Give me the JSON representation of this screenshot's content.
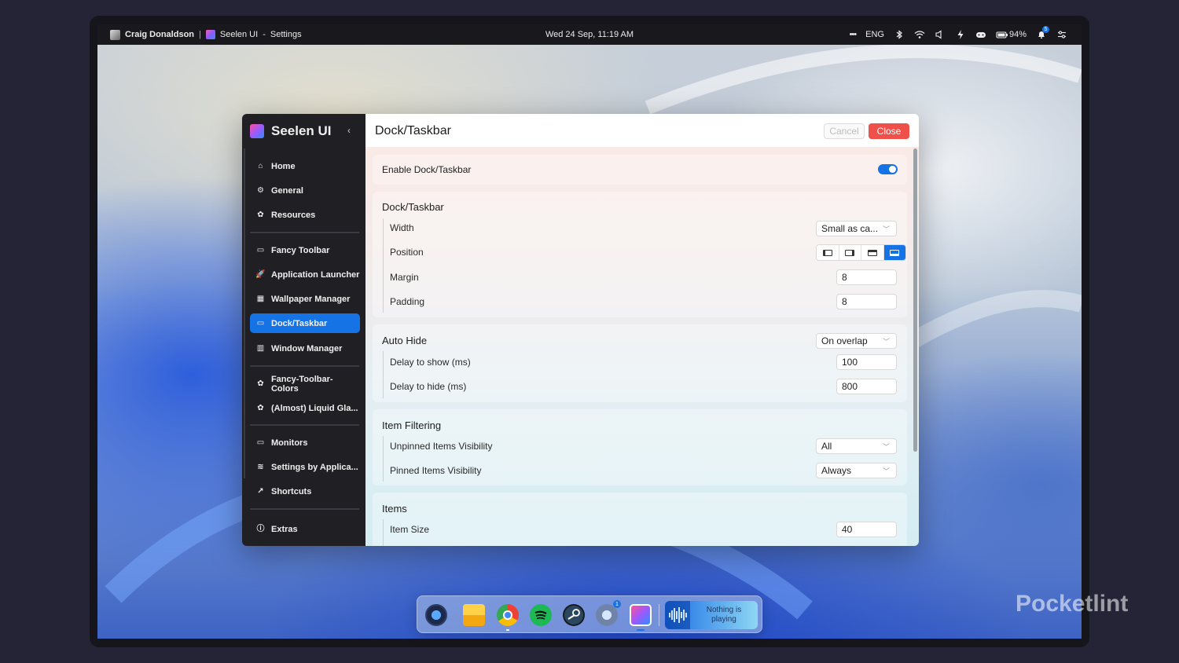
{
  "topbar": {
    "user": "Craig Donaldson",
    "separator": "|",
    "app_name": "Seelen UI",
    "app_dash": "-",
    "app_page": "Settings",
    "datetime": "Wed 24 Sep, 11:19 AM",
    "more": "•••",
    "language": "ENG",
    "battery": "94%",
    "notification_count": "5"
  },
  "sidebar": {
    "brand": "Seelen UI",
    "collapse": "‹",
    "items": [
      {
        "label": "Home",
        "icon": "⌂"
      },
      {
        "label": "General",
        "icon": "⚙"
      },
      {
        "label": "Resources",
        "icon": "✿"
      },
      {
        "label": "Fancy Toolbar",
        "icon": "▭"
      },
      {
        "label": "Application Launcher",
        "icon": "🚀"
      },
      {
        "label": "Wallpaper Manager",
        "icon": "▦"
      },
      {
        "label": "Dock/Taskbar",
        "icon": "▭"
      },
      {
        "label": "Window Manager",
        "icon": "▥"
      },
      {
        "label": "Fancy-Toolbar-Colors",
        "icon": "✿"
      },
      {
        "label": "(Almost) Liquid Gla...",
        "icon": "✿"
      },
      {
        "label": "Monitors",
        "icon": "▭"
      },
      {
        "label": "Settings by Applica...",
        "icon": "≋"
      },
      {
        "label": "Shortcuts",
        "icon": "↗"
      },
      {
        "label": "Extras",
        "icon": "ⓘ"
      }
    ]
  },
  "main": {
    "title": "Dock/Taskbar",
    "cancel_label": "Cancel",
    "close_label": "Close",
    "enable": {
      "label": "Enable Dock/Taskbar",
      "value": true
    },
    "dock_section": {
      "title": "Dock/Taskbar",
      "width_label": "Width",
      "width_value": "Small as ca...",
      "position_label": "Position",
      "margin_label": "Margin",
      "margin_value": "8",
      "padding_label": "Padding",
      "padding_value": "8"
    },
    "auto_hide": {
      "title": "Auto Hide",
      "mode_value": "On overlap",
      "delay_show_label": "Delay to show (ms)",
      "delay_show_value": "100",
      "delay_hide_label": "Delay to hide (ms)",
      "delay_hide_value": "800"
    },
    "item_filtering": {
      "title": "Item Filtering",
      "unpinned_label": "Unpinned Items Visibility",
      "unpinned_value": "All",
      "pinned_label": "Pinned Items Visibility",
      "pinned_value": "Always"
    },
    "items": {
      "title": "Items",
      "item_size_label": "Item Size",
      "item_size_value": "40"
    }
  },
  "dock": {
    "settings_badge": "1",
    "media_text_line1": "Nothing is",
    "media_text_line2": "playing"
  },
  "watermark": "Pocketlint",
  "colors": {
    "accent": "#1673e6",
    "close": "#f0504a",
    "sidebar": "#1f1f24"
  }
}
